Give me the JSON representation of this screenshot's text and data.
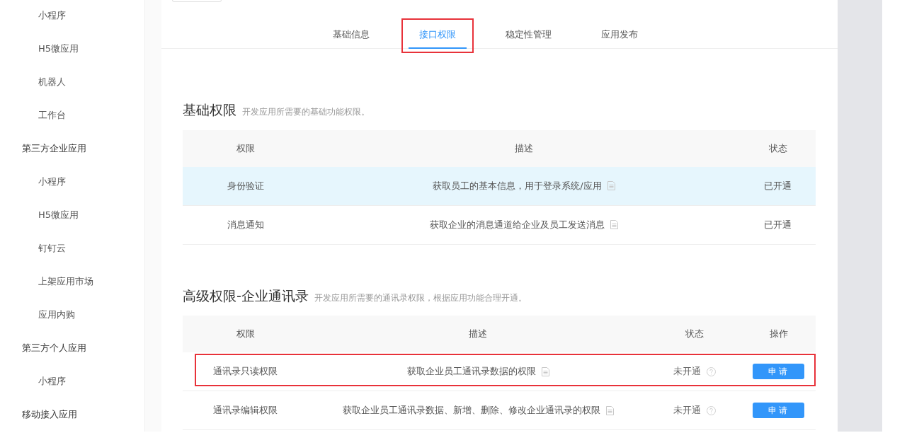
{
  "sidebar": {
    "items": [
      {
        "label": "小程序",
        "kind": "item"
      },
      {
        "label": "H5微应用",
        "kind": "item"
      },
      {
        "label": "机器人",
        "kind": "item"
      },
      {
        "label": "工作台",
        "kind": "item"
      },
      {
        "label": "第三方企业应用",
        "kind": "group"
      },
      {
        "label": "小程序",
        "kind": "item"
      },
      {
        "label": "H5微应用",
        "kind": "item"
      },
      {
        "label": "钉钉云",
        "kind": "item"
      },
      {
        "label": "上架应用市场",
        "kind": "item"
      },
      {
        "label": "应用内购",
        "kind": "item"
      },
      {
        "label": "第三方个人应用",
        "kind": "group"
      },
      {
        "label": "小程序",
        "kind": "item"
      },
      {
        "label": "移动接入应用",
        "kind": "group"
      }
    ]
  },
  "tabs": [
    {
      "label": "基础信息",
      "selected": false,
      "annotated": false
    },
    {
      "label": "接口权限",
      "selected": true,
      "annotated": true
    },
    {
      "label": "稳定性管理",
      "selected": false,
      "annotated": false
    },
    {
      "label": "应用发布",
      "selected": false,
      "annotated": false
    }
  ],
  "sections": [
    {
      "title": "基础权限",
      "subtitle": "开发应用所需要的基础功能权限。",
      "columns": [
        "权限",
        "描述",
        "状态"
      ],
      "rows": [
        {
          "name": "身份验证",
          "description": "获取员工的基本信息，用于登录系统/应用",
          "status": "已开通",
          "enabled": true,
          "selected": true,
          "annotated": false
        },
        {
          "name": "消息通知",
          "description": "获取企业的消息通道给企业及员工发送消息",
          "status": "已开通",
          "enabled": true,
          "selected": false,
          "annotated": false
        }
      ]
    },
    {
      "title": "高级权限-企业通讯录",
      "subtitle": "开发应用所需要的通讯录权限，根据应用功能合理开通。",
      "columns": [
        "权限",
        "描述",
        "状态",
        "操作"
      ],
      "rows": [
        {
          "name": "通讯录只读权限",
          "description": "获取企业员工通讯录数据的权限",
          "status": "未开通",
          "enabled": false,
          "action": "申请",
          "selected": false,
          "annotated": true
        },
        {
          "name": "通讯录编辑权限",
          "description": "获取企业员工通讯录数据、新增、删除、修改企业通讯录的权限",
          "status": "未开通",
          "enabled": false,
          "action": "申请",
          "selected": false,
          "annotated": false
        }
      ]
    }
  ]
}
